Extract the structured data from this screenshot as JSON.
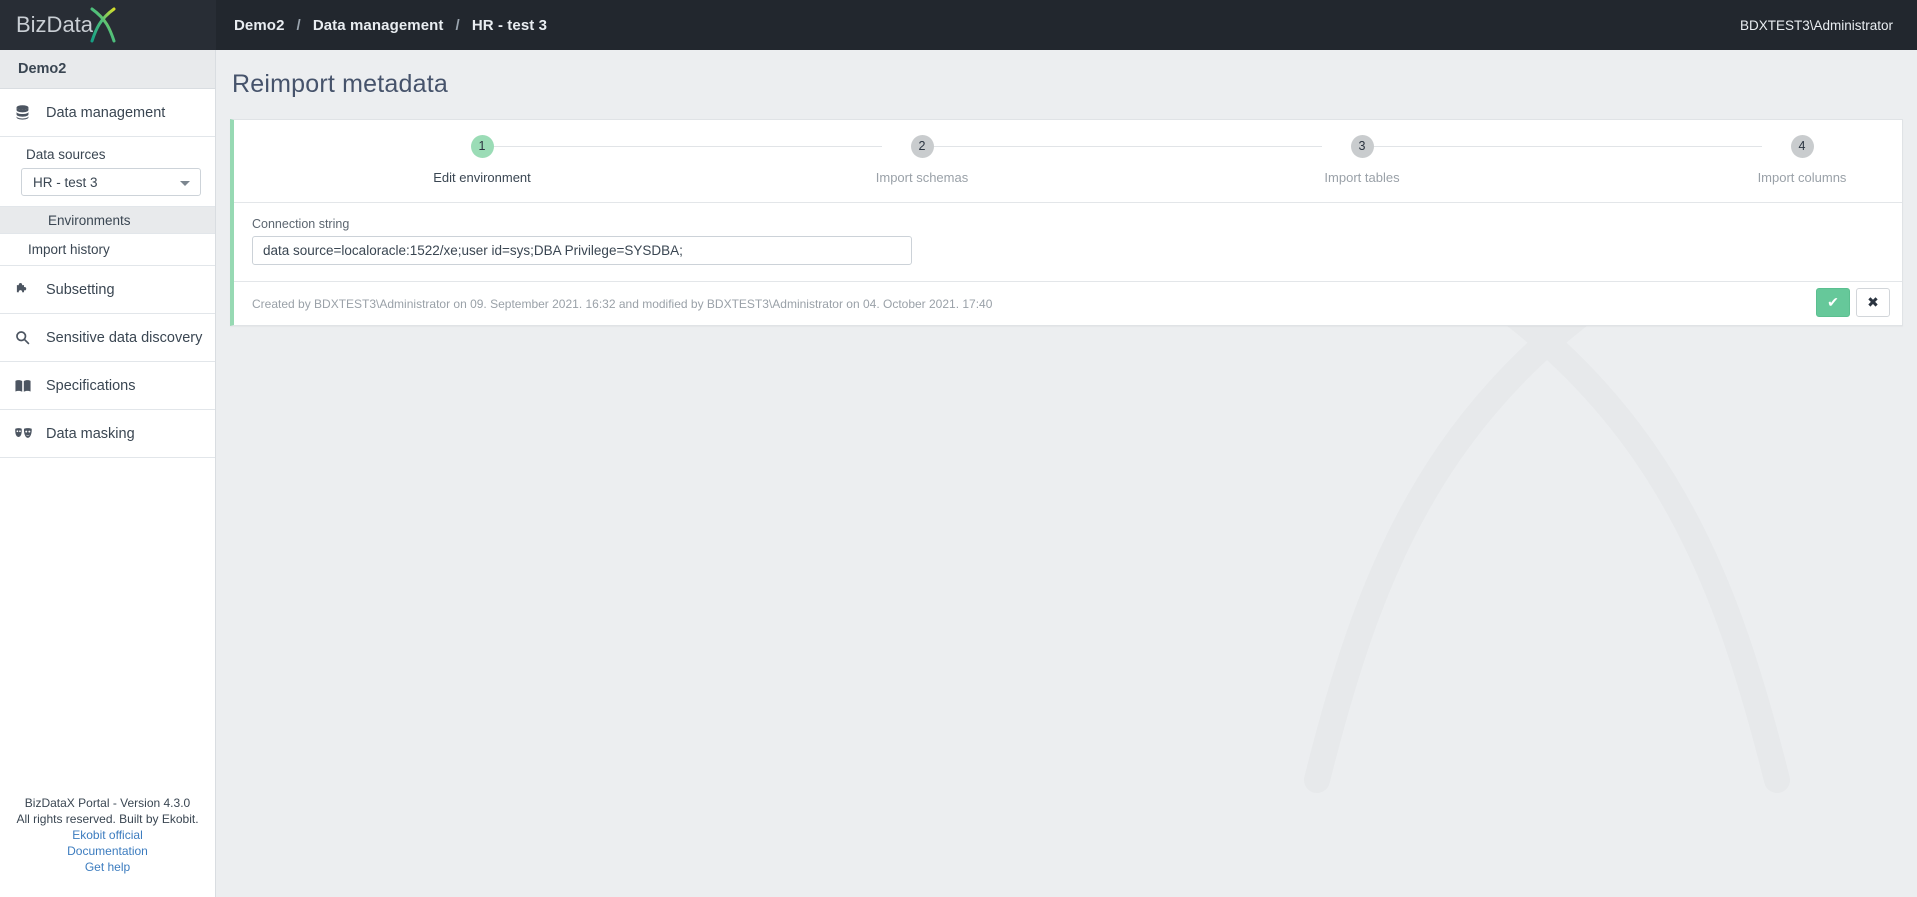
{
  "topbar": {
    "logo_text": "BizData",
    "logo_mark": "X",
    "breadcrumb": [
      "Demo2",
      "Data management",
      "HR - test 3"
    ],
    "breadcrumb_separator": "/",
    "user": "BDXTEST3\\Administrator"
  },
  "sidebar": {
    "project": "Demo2",
    "data_management": {
      "label": "Data management",
      "icon": "database-icon"
    },
    "data_sources_label": "Data sources",
    "data_source_selected": "HR - test 3",
    "sub_items": [
      {
        "label": "Environments",
        "active": true
      },
      {
        "label": "Import history",
        "active": false
      }
    ],
    "items": [
      {
        "label": "Subsetting",
        "icon": "puzzle-icon"
      },
      {
        "label": "Sensitive data discovery",
        "icon": "search-icon"
      },
      {
        "label": "Specifications",
        "icon": "book-icon"
      },
      {
        "label": "Data masking",
        "icon": "masks-icon"
      }
    ],
    "footer": {
      "version": "BizDataX Portal - Version 4.3.0",
      "rights": "All rights reserved. Built by Ekobit.",
      "links": [
        "Ekobit official",
        "Documentation",
        "Get help"
      ]
    }
  },
  "main": {
    "page_title": "Reimport metadata",
    "stepper": [
      {
        "number": "1",
        "label": "Edit environment",
        "active": true
      },
      {
        "number": "2",
        "label": "Import schemas",
        "active": false
      },
      {
        "number": "3",
        "label": "Import tables",
        "active": false
      },
      {
        "number": "4",
        "label": "Import columns",
        "active": false
      }
    ],
    "form": {
      "connection_string_label": "Connection string",
      "connection_string_value": "data source=localoracle:1522/xe;user id=sys;DBA Privilege=SYSDBA;",
      "connection_string_placeholder": "Connection string"
    },
    "meta": "Created by BDXTEST3\\Administrator on 09. September 2021. 16:32 and modified by BDXTEST3\\Administrator on 04. October 2021. 17:40",
    "buttons": {
      "save": "✔",
      "cancel": "✖"
    }
  },
  "colors": {
    "topbar_bg": "#22272e",
    "accent_green": "#66c89a",
    "step_active": "#9bdcb6",
    "step_inactive": "#c9ccce",
    "link_blue": "#3c7cbf"
  }
}
